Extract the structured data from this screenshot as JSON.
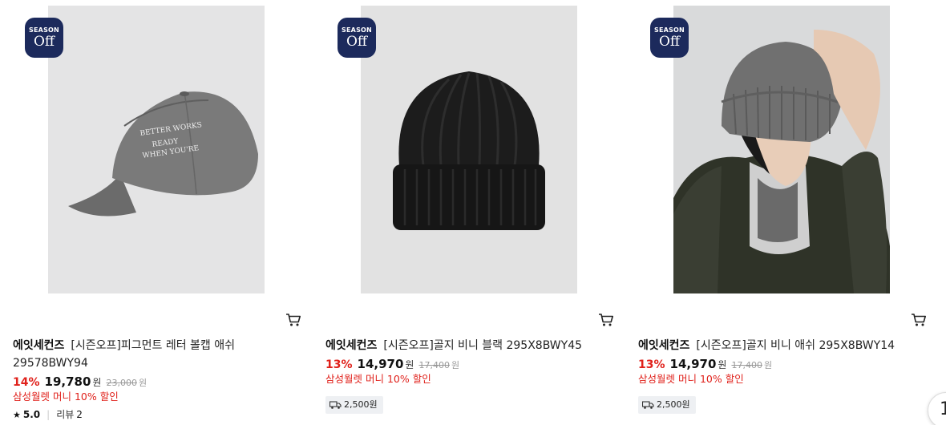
{
  "badge": {
    "line1": "SEASON",
    "line2": "Off"
  },
  "products": [
    {
      "brand": "에잇세컨즈",
      "name": "[시즌오프]피그먼트 레터 볼캡 애쉬 29578BWY94",
      "discount": "14%",
      "price": "19,780",
      "currency": "원",
      "original_price": "23,000",
      "original_currency": "원",
      "promo": "삼성월렛 머니 10% 할인",
      "rating": {
        "score": "5.0",
        "review_label": "리뷰",
        "review_count": "2"
      },
      "image_icon": "gray-baseball-cap",
      "cart_icon": "cart-icon"
    },
    {
      "brand": "에잇세컨즈",
      "name": "[시즌오프]골지 비니 블랙 295X8BWY45",
      "discount": "13%",
      "price": "14,970",
      "currency": "원",
      "original_price": "17,400",
      "original_currency": "원",
      "promo": "삼성월렛 머니 10% 할인",
      "shipping": "2,500원",
      "image_icon": "black-beanie",
      "cart_icon": "cart-icon"
    },
    {
      "brand": "에잇세컨즈",
      "name": "[시즌오프]골지 비니 애쉬 295X8BWY14",
      "discount": "13%",
      "price": "14,970",
      "currency": "원",
      "original_price": "17,400",
      "original_currency": "원",
      "promo": "삼성월렛 머니 10% 할인",
      "shipping": "2,500원",
      "image_icon": "model-wearing-gray-beanie",
      "cart_icon": "cart-icon"
    }
  ],
  "page_indicator": "1",
  "colors": {
    "accent_red": "#e0211b",
    "badge_navy": "#1c2a5c"
  }
}
